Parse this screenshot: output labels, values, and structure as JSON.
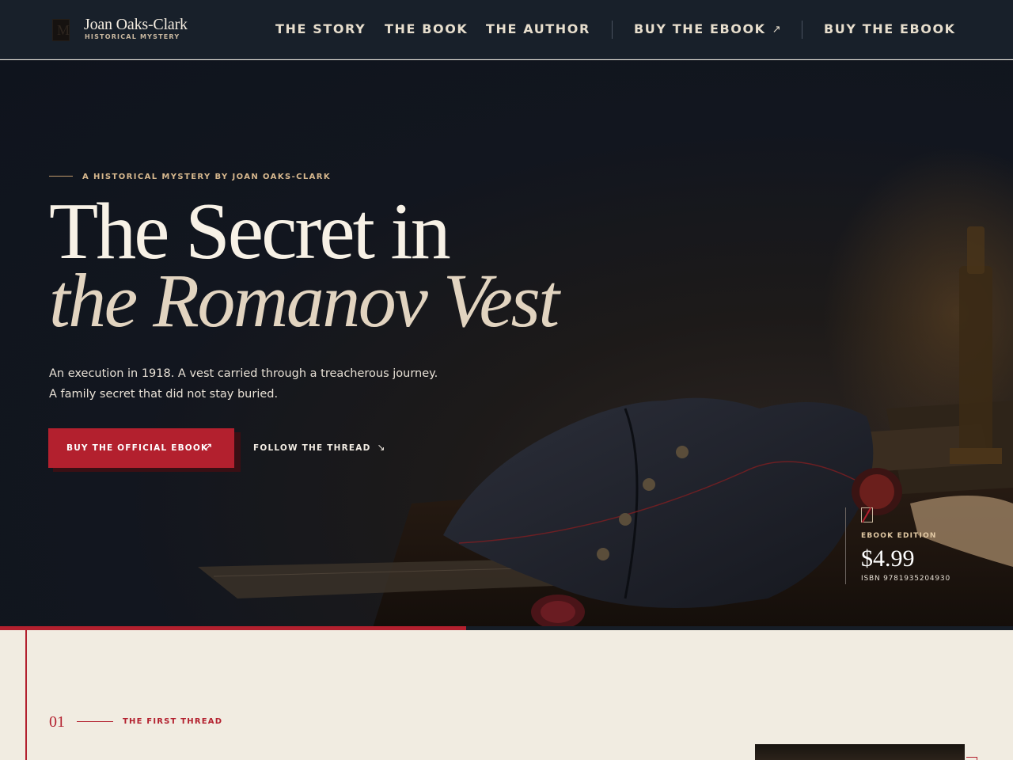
{
  "brand": {
    "name": "Joan Oaks-Clark",
    "tagline": "HISTORICAL MYSTERY"
  },
  "nav": {
    "links": [
      "THE STORY",
      "THE BOOK",
      "THE AUTHOR"
    ],
    "buy_external": "BUY THE EBOOK",
    "buy": "BUY THE EBOOK"
  },
  "hero": {
    "eyebrow": "A HISTORICAL MYSTERY BY JOAN OAKS-CLARK",
    "title_line1": "The Secret in",
    "title_line2": "the Romanov Vest",
    "lede": "An execution in 1918. A vest carried through a treacherous journey. A family secret that did not stay buried.",
    "primary_cta": "BUY THE OFFICIAL EBOOK",
    "secondary_cta": "FOLLOW THE THREAD"
  },
  "edition": {
    "label": "EBOOK EDITION",
    "price": "$4.99",
    "isbn": "ISBN 9781935204930"
  },
  "scroll_progress": 0.46,
  "section": {
    "number": "01",
    "label": "THE FIRST THREAD"
  },
  "icons": {
    "brand": "brand-monogram-icon",
    "external": "arrow-up-right-icon",
    "down": "arrow-down-right-icon",
    "edition": "ebook-icon"
  },
  "colors": {
    "accent": "#b3202e",
    "nav_bg": "#18202a",
    "hero_bg": "#0f141d",
    "cream": "#f1ece1",
    "gold": "#d6b78d"
  }
}
